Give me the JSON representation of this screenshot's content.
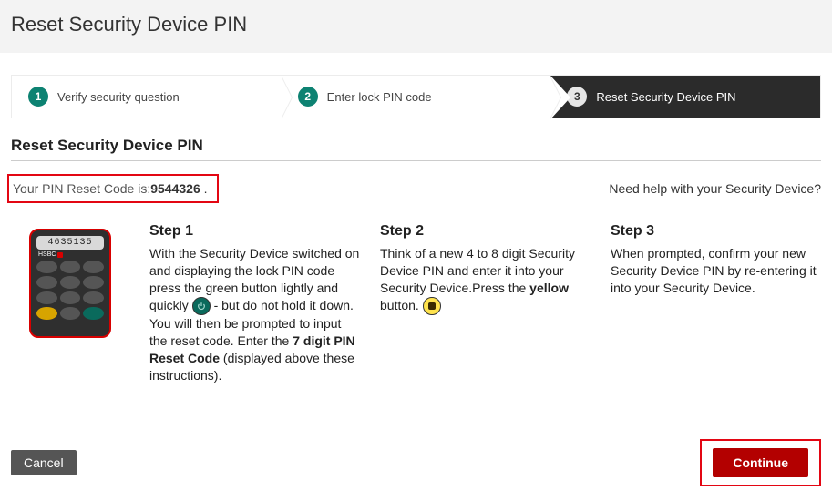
{
  "header": {
    "title": "Reset Security Device PIN"
  },
  "wizard": {
    "steps": [
      {
        "num": "1",
        "label": "Verify security question"
      },
      {
        "num": "2",
        "label": "Enter lock PIN code"
      },
      {
        "num": "3",
        "label": "Reset Security Device PIN"
      }
    ]
  },
  "section": {
    "title": "Reset Security Device PIN"
  },
  "reset_code": {
    "label": "Your PIN Reset Code is:",
    "value": "9544326",
    "suffix": " ."
  },
  "help": {
    "link_text": "Need help with your Security Device?"
  },
  "device": {
    "screen_value": "4635135",
    "brand": "HSBC"
  },
  "steps": {
    "step1": {
      "title": "Step 1",
      "text_a": "With the Security Device switched on and displaying the lock PIN code press the green button lightly and quickly ",
      "text_b": " - but do not hold it down. You will then be prompted to input the reset code. Enter the ",
      "bold_b": "7 digit PIN Reset Code",
      "text_c": " (displayed above  these  instructions)."
    },
    "step2": {
      "title": "Step 2",
      "text_a": "Think of a new 4 to 8 digit Security Device PIN and enter it into your Security Device.Press the ",
      "bold_a": "yellow",
      "text_b": " button. "
    },
    "step3": {
      "title": "Step 3",
      "text_a": "When prompted, confirm your new Security Device PIN by re-entering it into your Security Device."
    }
  },
  "footer": {
    "cancel": "Cancel",
    "continue": "Continue"
  },
  "colors": {
    "highlight_border": "#e30613",
    "accent": "#0d8272",
    "continue_bg": "#b30000"
  }
}
